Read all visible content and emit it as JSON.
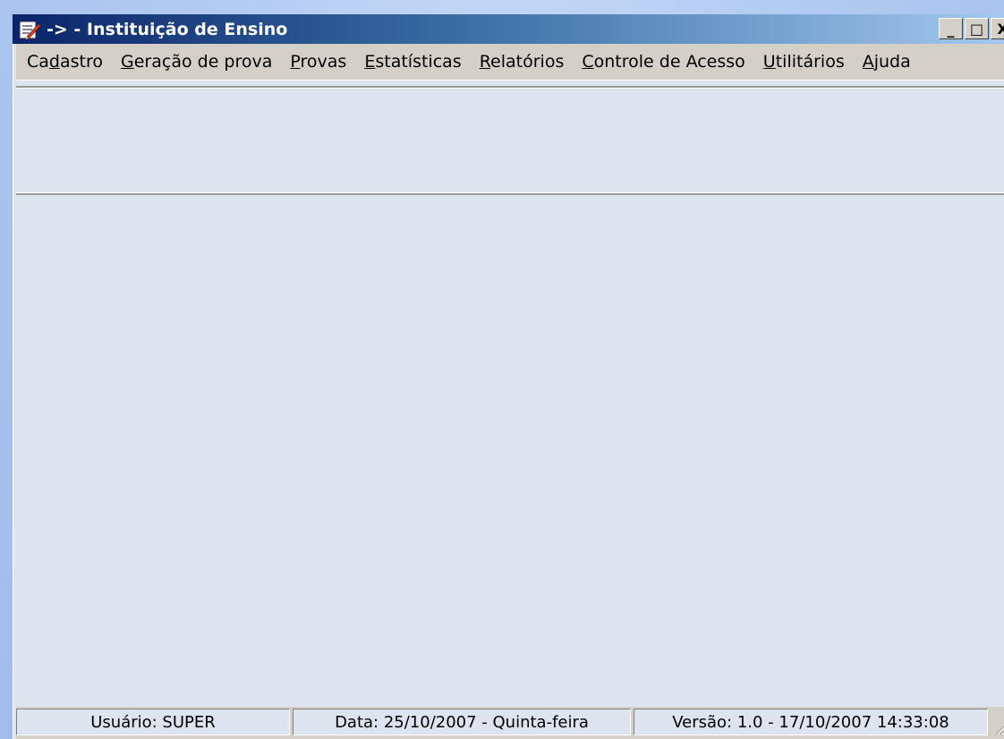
{
  "window": {
    "title": "-> - Instituição de Ensino"
  },
  "caption_buttons": {
    "minimize": "_",
    "maximize": "□",
    "close": "X"
  },
  "menu": {
    "items": [
      {
        "pre": "Ca",
        "acc": "d",
        "post": "astro"
      },
      {
        "pre": "",
        "acc": "G",
        "post": "eração de prova"
      },
      {
        "pre": "",
        "acc": "P",
        "post": "rovas"
      },
      {
        "pre": "",
        "acc": "E",
        "post": "statísticas"
      },
      {
        "pre": "",
        "acc": "R",
        "post": "elatórios"
      },
      {
        "pre": "",
        "acc": "C",
        "post": "ontrole de Acesso"
      },
      {
        "pre": "",
        "acc": "U",
        "post": "tilitários"
      },
      {
        "pre": "",
        "acc": "A",
        "post": "juda"
      }
    ]
  },
  "statusbar": {
    "user": "Usuário: SUPER",
    "date": "Data: 25/10/2007 - Quinta-feira",
    "version": "Versão: 1.0  -  17/10/2007 14:33:08"
  },
  "colors": {
    "title_gradient_start": "#0a246a",
    "title_gradient_end": "#a6caf0",
    "client_bg": "#dde3ef",
    "chrome_bg": "#d4d0c8"
  }
}
